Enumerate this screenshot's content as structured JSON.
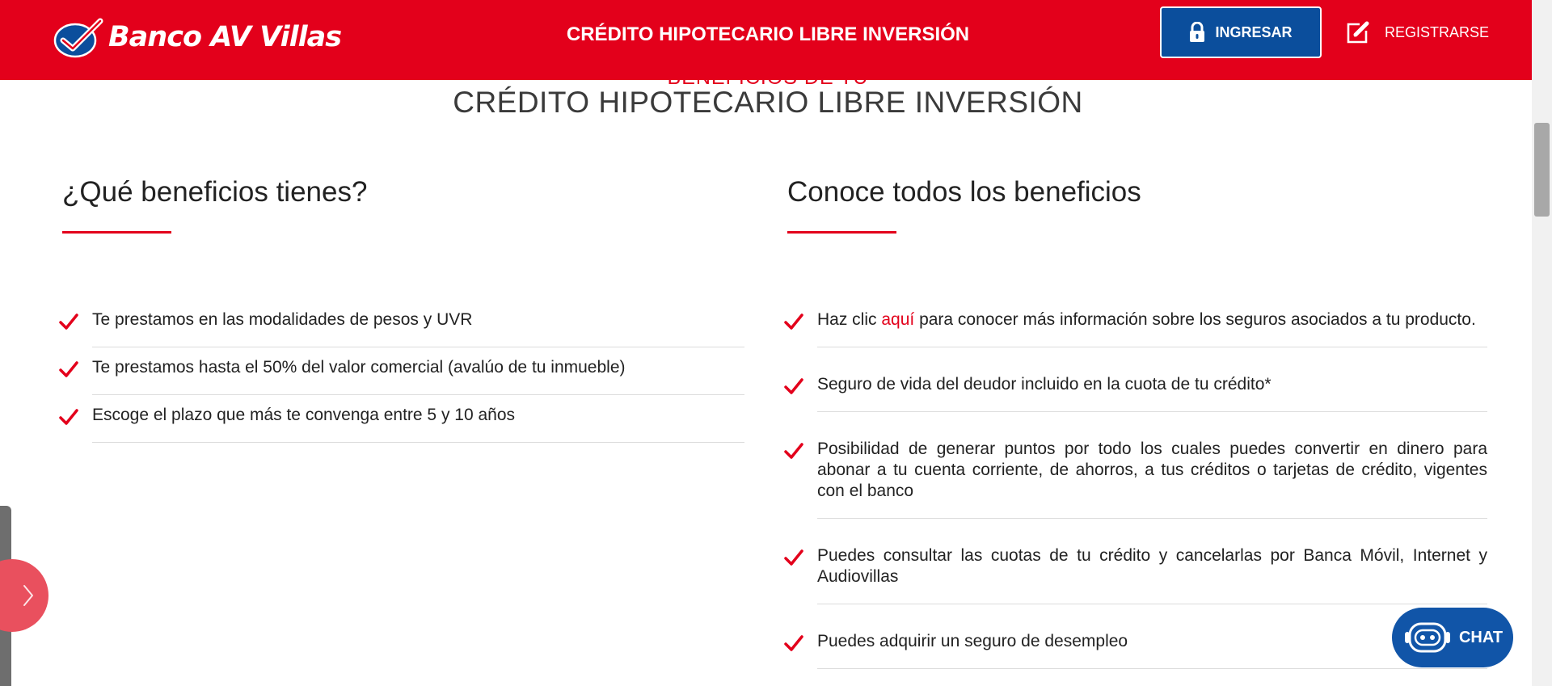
{
  "colors": {
    "brand_red": "#e3001b",
    "brand_blue": "#0b4e9c",
    "chat_blue": "#1155a8"
  },
  "header": {
    "logo_text": "Banco AV Villas",
    "title": "CRÉDITO HIPOTECARIO LIBRE INVERSIÓN",
    "login_label": "INGRESAR",
    "login_icon": "lock-icon",
    "register_label": "REGISTRARSE",
    "register_icon": "edit-icon"
  },
  "section": {
    "sup_title": "BENEFICIOS DE TU",
    "title": "CRÉDITO HIPOTECARIO LIBRE INVERSIÓN"
  },
  "left": {
    "heading": "¿Qué beneficios tienes?",
    "items": [
      "Te prestamos en las modalidades de pesos y UVR",
      "Te prestamos hasta el 50% del valor comercial (avalúo de tu inmueble)",
      "Escoge el plazo que más te convenga entre 5 y 10 años"
    ]
  },
  "right": {
    "heading": "Conoce todos los beneficios",
    "item0_pre": "Haz clic ",
    "item0_link": "aquí",
    "item0_post": " para conocer más información sobre los seguros asociados a tu producto.",
    "items": [
      "Seguro de vida del deudor incluido en la cuota de tu crédito*",
      "Posibilidad de generar puntos por todo los cuales puedes convertir en dinero para abonar a tu cuenta corriente, de ahorros, a tus créditos o tarjetas de crédito, vigentes con el banco",
      "Puedes consultar las cuotas de tu crédito y cancelarlas por Banca Móvil, Internet y Audiovillas",
      "Puedes adquirir un seguro de desempleo"
    ]
  },
  "chat": {
    "label": "CHAT",
    "icon": "robot-icon"
  },
  "side": {
    "icon": "chevron-right-icon"
  }
}
